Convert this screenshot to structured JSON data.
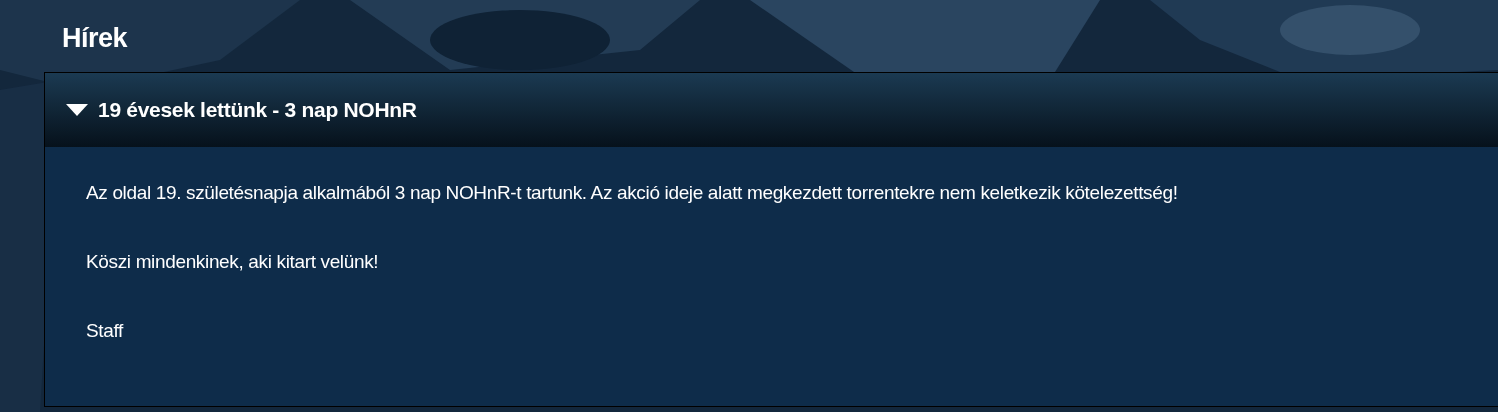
{
  "page_title": "Hírek",
  "news": [
    {
      "title": "19 évesek lettünk - 3 nap NOHnR",
      "expanded": true,
      "paragraphs": [
        "Az oldal 19. születésnapja alkalmából 3 nap NOHnR-t tartunk. Az akció ideje alatt megkezdett torrentekre nem keletkezik kötelezettség!",
        "Köszi mindenkinek, aki kitart velünk!",
        "Staff"
      ]
    }
  ]
}
